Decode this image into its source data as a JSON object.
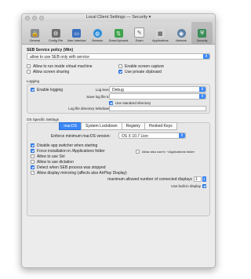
{
  "window": {
    "title": "Local Client Settings — Security ▾"
  },
  "toolbar": {
    "items": [
      {
        "label": "General",
        "icon": "lock-icon"
      },
      {
        "label": "Config File",
        "icon": "config-file-icon"
      },
      {
        "label": "User Interface",
        "icon": "user-interface-icon"
      },
      {
        "label": "Browser",
        "icon": "globe-icon"
      },
      {
        "label": "Down/Uploads",
        "icon": "download-upload-icon"
      },
      {
        "label": "Exam",
        "icon": "exam-icon"
      },
      {
        "label": "Applications",
        "icon": "applications-icon"
      },
      {
        "label": "Network",
        "icon": "network-icon"
      },
      {
        "label": "Security",
        "icon": "security-icon"
      }
    ],
    "active": "Security"
  },
  "service": {
    "heading": "SEB Service policy (Win)",
    "value": "allow to use SEB only with service"
  },
  "options": {
    "allow_vm": "Allow to run inside virtual machine",
    "allow_sharing": "Allow screen sharing",
    "screen_capture": "Enable screen capture",
    "private_clipboard": "Use private clipboard"
  },
  "logging": {
    "title": "Logging",
    "enable": "Enable logging",
    "log_level_label": "Log level:",
    "log_level_value": "Debug",
    "save_label": "Save log file to:",
    "save_value": "",
    "standard_dir": "Use standard directory",
    "dir_windows_label": "Log file directory Windows:"
  },
  "os": {
    "title": "OS Specific Settings",
    "tabs": [
      "macOS",
      "System Lockdown",
      "Registry",
      "Hooked Keys"
    ],
    "selected_tab": "macOS",
    "min_version_label": "Enforce minimum macOS version:",
    "min_version_value": "OS X 10.7 Lion",
    "checks": [
      {
        "label": "Disable app switcher when starting",
        "on": true
      },
      {
        "label": "Force installation in /Applications folder",
        "on": true
      },
      {
        "label": "Allow to use Siri",
        "on": false
      },
      {
        "label": "Allow to use dictation",
        "on": false
      },
      {
        "label": "Detect when SEB process was stopped",
        "on": true
      },
      {
        "label": "Allow display mirroring (affects also AirPlay Display)",
        "on": false
      }
    ],
    "allow_users_apps": "Allow also user's ~/Applications folder",
    "max_displays_label": "maximum allowed number of connected displays",
    "max_displays_value": "1",
    "builtin_display": "Use built-in display"
  },
  "colors": {
    "accent": "#3b87f6",
    "window_bg": "#ececec"
  }
}
